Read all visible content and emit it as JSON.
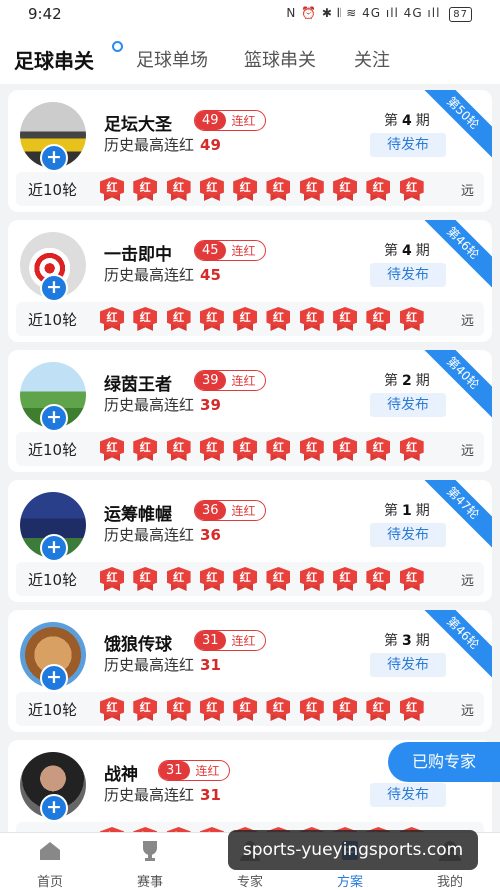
{
  "status": {
    "time": "9:42",
    "icons": "N ⏰ ✱ 𝄃 ≋ 4G ıll 4G ıll",
    "battery": "87"
  },
  "tabs": [
    {
      "label": "足球串关",
      "active": true
    },
    {
      "label": "足球单场",
      "active": false
    },
    {
      "label": "篮球串关",
      "active": false
    },
    {
      "label": "关注",
      "active": false
    }
  ],
  "common": {
    "streak_label": "连红",
    "history_label": "历史最高连红",
    "period_prefix": "第",
    "period_suffix": "期",
    "pending_label": "待发布",
    "recent_label": "近10轮",
    "chip_text": "红",
    "far_label": "远"
  },
  "experts": [
    {
      "name": "足坛大圣",
      "streak": "49",
      "history": "49",
      "period": "4",
      "ribbon": "第50轮",
      "avatar": "car"
    },
    {
      "name": "一击即中",
      "streak": "45",
      "history": "45",
      "period": "4",
      "ribbon": "第46轮",
      "avatar": "dart"
    },
    {
      "name": "绿茵王者",
      "streak": "39",
      "history": "39",
      "period": "2",
      "ribbon": "第40轮",
      "avatar": "field"
    },
    {
      "name": "运筹帷幄",
      "streak": "36",
      "history": "36",
      "period": "1",
      "ribbon": "第47轮",
      "avatar": "player"
    },
    {
      "name": "饿狼传球",
      "streak": "31",
      "history": "31",
      "period": "3",
      "ribbon": "第46轮",
      "avatar": "mask"
    },
    {
      "name": "战神",
      "streak": "31",
      "history": "31",
      "period": "",
      "ribbon": "",
      "avatar": "man"
    }
  ],
  "floating": {
    "bought": "已购专家"
  },
  "watermark": "sports-yueyingsports.com",
  "bottom_nav": [
    {
      "label": "首页",
      "icon": "home-icon"
    },
    {
      "label": "赛事",
      "icon": "trophy-icon"
    },
    {
      "label": "专家",
      "icon": "expert-icon"
    },
    {
      "label": "方案",
      "icon": "plan-icon",
      "active": true
    },
    {
      "label": "我的",
      "icon": "profile-icon"
    }
  ],
  "colors": {
    "accent": "#2a8cf0",
    "red": "#e23a3a",
    "pending_bg": "#e9f2fc"
  }
}
